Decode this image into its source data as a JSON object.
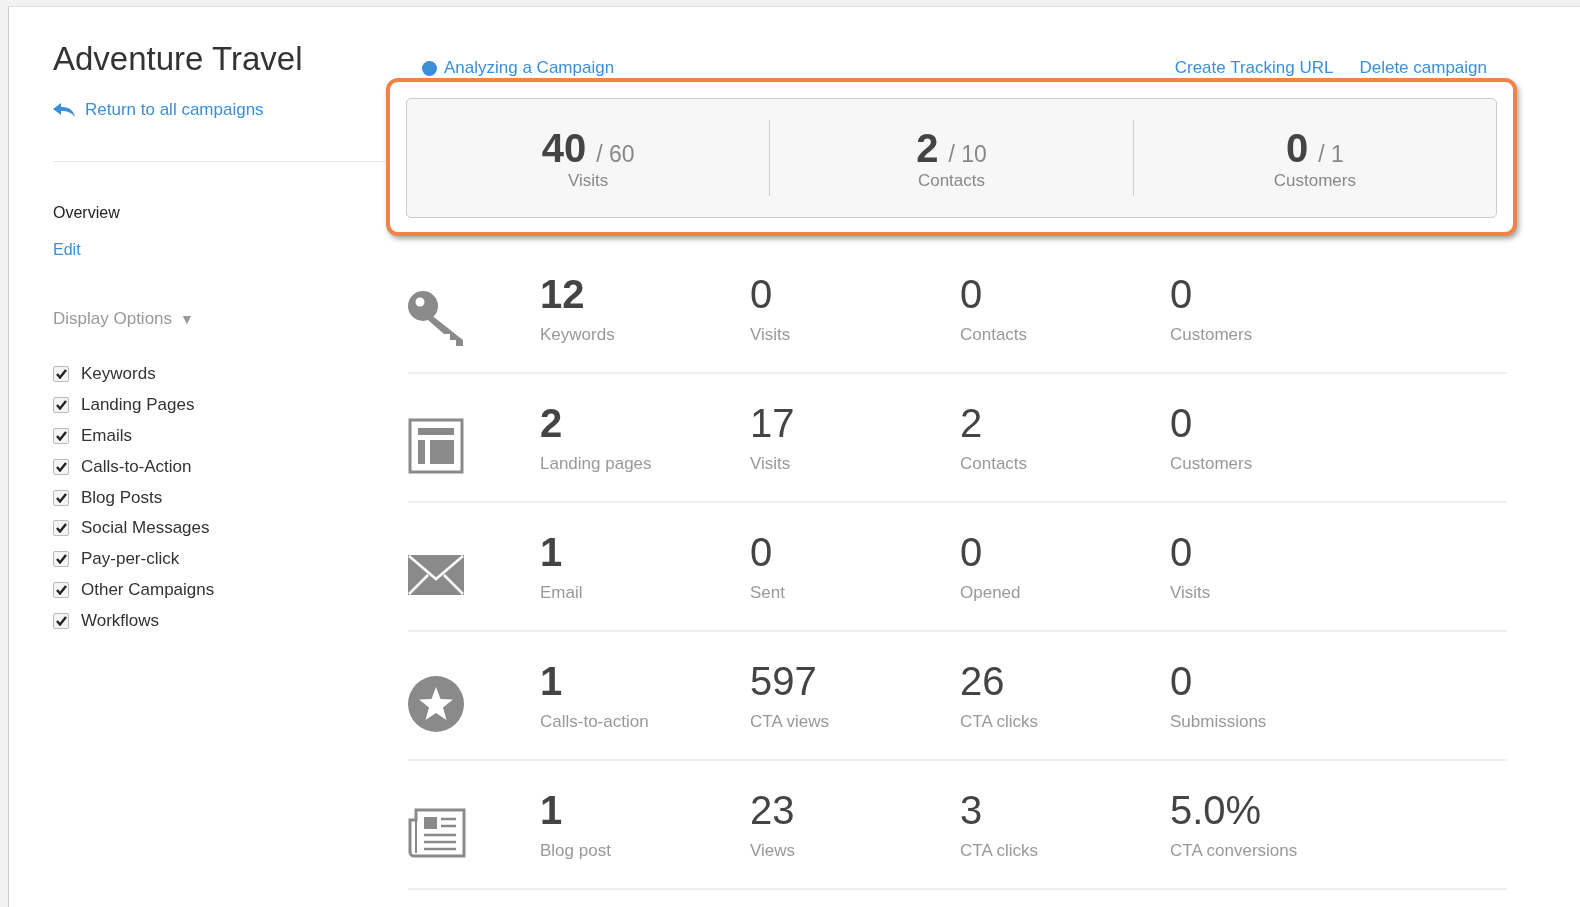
{
  "header": {
    "title": "Adventure Travel",
    "help_link": "Analyzing a Campaign",
    "actions": [
      "Create Tracking URL",
      "Delete campaign"
    ]
  },
  "sidebar": {
    "back_link": "Return to all campaigns",
    "nav": [
      {
        "label": "Overview",
        "selected": true
      },
      {
        "label": "Edit",
        "selected": false
      }
    ],
    "display_options": "Display Options",
    "dropdown_caret": "▼",
    "options": [
      {
        "label": "Keywords",
        "checked": true
      },
      {
        "label": "Landing Pages",
        "checked": true
      },
      {
        "label": "Emails",
        "checked": true
      },
      {
        "label": "Calls-to-Action",
        "checked": true
      },
      {
        "label": "Blog Posts",
        "checked": true
      },
      {
        "label": "Social Messages",
        "checked": true
      },
      {
        "label": "Pay-per-click",
        "checked": true
      },
      {
        "label": "Other Campaigns",
        "checked": true
      },
      {
        "label": "Workflows",
        "checked": true
      }
    ]
  },
  "summary": [
    {
      "value": "40",
      "goal": "/ 60",
      "label": "Visits"
    },
    {
      "value": "2",
      "goal": "/ 10",
      "label": "Contacts"
    },
    {
      "value": "0",
      "goal": "/ 1",
      "label": "Customers"
    }
  ],
  "rows": [
    {
      "kind": "key",
      "stats": [
        {
          "value": "12",
          "label": "Keywords"
        },
        {
          "value": "0",
          "label": "Visits"
        },
        {
          "value": "0",
          "label": "Contacts"
        },
        {
          "value": "0",
          "label": "Customers"
        }
      ]
    },
    {
      "kind": "layout",
      "stats": [
        {
          "value": "2",
          "label": "Landing pages"
        },
        {
          "value": "17",
          "label": "Visits"
        },
        {
          "value": "2",
          "label": "Contacts"
        },
        {
          "value": "0",
          "label": "Customers"
        }
      ]
    },
    {
      "kind": "envelope",
      "stats": [
        {
          "value": "1",
          "label": "Email"
        },
        {
          "value": "0",
          "label": "Sent"
        },
        {
          "value": "0",
          "label": "Opened"
        },
        {
          "value": "0",
          "label": "Visits"
        }
      ]
    },
    {
      "kind": "star",
      "stats": [
        {
          "value": "1",
          "label": "Calls-to-action"
        },
        {
          "value": "597",
          "label": "CTA views"
        },
        {
          "value": "26",
          "label": "CTA clicks"
        },
        {
          "value": "0",
          "label": "Submissions"
        }
      ]
    },
    {
      "kind": "newspaper",
      "stats": [
        {
          "value": "1",
          "label": "Blog post"
        },
        {
          "value": "23",
          "label": "Views"
        },
        {
          "value": "3",
          "label": "CTA clicks"
        },
        {
          "value": "5.0%",
          "label": "CTA conversions"
        }
      ]
    }
  ]
}
